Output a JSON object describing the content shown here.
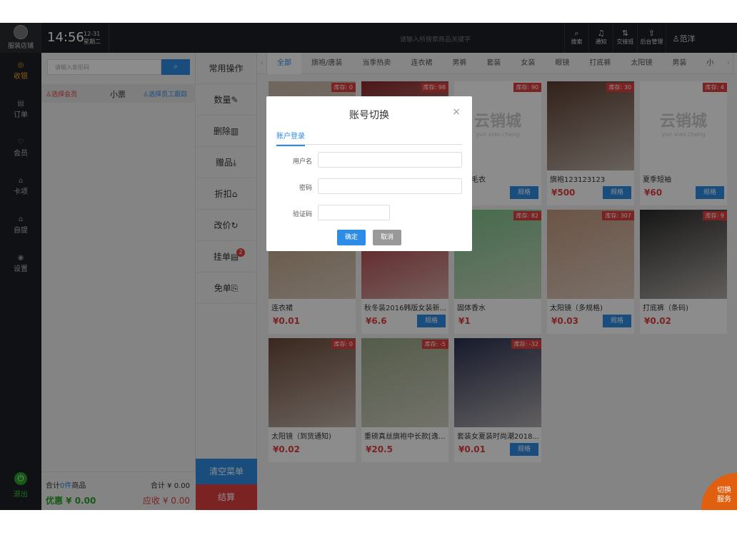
{
  "store": {
    "name": "服装店铺"
  },
  "time": {
    "clock": "14:56",
    "date": "12-31",
    "weekday": "星期二"
  },
  "topbar": {
    "search_placeholder": "请输入所搜索商品关键字",
    "buttons": [
      {
        "label": "搜索",
        "icon": "search-icon"
      },
      {
        "label": "通知",
        "icon": "bell-icon"
      },
      {
        "label": "交接班",
        "icon": "swap-icon"
      },
      {
        "label": "后台管理",
        "icon": "upload-icon"
      }
    ],
    "user": "范洋"
  },
  "nav": [
    {
      "label": "收银",
      "icon": "cashier-icon",
      "active": true
    },
    {
      "label": "订单",
      "icon": "order-icon"
    },
    {
      "label": "会员",
      "icon": "member-icon"
    },
    {
      "label": "卡项",
      "icon": "card-icon"
    },
    {
      "label": "自提",
      "icon": "pickup-icon"
    },
    {
      "label": "设置",
      "icon": "settings-icon"
    }
  ],
  "logout": "退出",
  "cart": {
    "barcode_placeholder": "请输入条形码",
    "member": "选择会员",
    "ticket": "小票",
    "staff": "选择员工跟踪",
    "total_prefix": "合计",
    "total_count": "0件",
    "total_suffix": "商品",
    "total_amount": "合计 ¥ 0.00",
    "discount": "优惠 ¥ 0.00",
    "receivable": "应收 ¥ 0.00"
  },
  "ops": {
    "header": "常用操作",
    "items": [
      "数量",
      "删除",
      "赠品",
      "折扣",
      "改价",
      "挂单",
      "免单"
    ],
    "hold_badge": "2",
    "clear": "清空菜单",
    "checkout": "结算"
  },
  "tabs": [
    "全部",
    "旗袍/唐装",
    "当季热卖",
    "连衣裙",
    "男裤",
    "套装",
    "女装",
    "眼镜",
    "打底裤",
    "太阳镜",
    "男装",
    "小"
  ],
  "products": [
    {
      "stock": "库存: 0",
      "name": "",
      "price": "",
      "spec": false,
      "img": "#c9b9a8"
    },
    {
      "stock": "库存: 98",
      "name": "",
      "price": "",
      "spec": false,
      "img": "#8a2a2a"
    },
    {
      "stock": "库存: 90",
      "name": "新款毛衣",
      "price": "00",
      "spec": true,
      "img": "logo"
    },
    {
      "stock": "库存: 30",
      "name": "旗袍123123123",
      "price": "¥500",
      "spec": true,
      "img": "#5a3d30"
    },
    {
      "stock": "库存: 4",
      "name": "夏季短袖",
      "price": "¥60",
      "spec": true,
      "img": "logo"
    },
    {
      "stock": "",
      "name": "连衣裙",
      "price": "¥0.01",
      "spec": false,
      "img": "#b89a78"
    },
    {
      "stock": "",
      "name": "秋冬装2016韩版女装新...",
      "price": "¥6.6",
      "spec": true,
      "img": "#a82830"
    },
    {
      "stock": "库存: 82",
      "name": "固体香水",
      "price": "¥1",
      "spec": false,
      "img": "#7ec48a"
    },
    {
      "stock": "库存: 307",
      "name": "太阳镜（多规格)",
      "price": "¥0.03",
      "spec": true,
      "img": "#c49a80"
    },
    {
      "stock": "库存: 9",
      "name": "打底裤（条码)",
      "price": "¥0.02",
      "spec": false,
      "img": "#2a2a2a"
    },
    {
      "stock": "库存: 0",
      "name": "太阳镜（到货通知)",
      "price": "¥0.02",
      "spec": false,
      "img": "#6b4a3a"
    },
    {
      "stock": "库存: -5",
      "name": "重磅真丝旗袍中长款[逸...",
      "price": "¥20.5",
      "spec": false,
      "img": "#9aa888"
    },
    {
      "stock": "库存: -32",
      "name": "套装女夏装时尚潮2018...",
      "price": "¥0.01",
      "spec": true,
      "img": "#2a3050"
    }
  ],
  "spec_label": "规格",
  "logo_text": {
    "cn": "云销城",
    "en": "yun xiao cheng"
  },
  "corner": {
    "line1": "切换",
    "line2": "服务"
  },
  "modal": {
    "title": "账号切换",
    "close": "×",
    "tab": "账户登录",
    "username_label": "用户名",
    "password_label": "密码",
    "captcha_label": "验证码",
    "ok": "确定",
    "cancel": "取消"
  },
  "colors": {
    "accent": "#2d8ce6",
    "danger": "#e04040",
    "success": "#2aa52a",
    "nav_active": "#f5a623"
  }
}
